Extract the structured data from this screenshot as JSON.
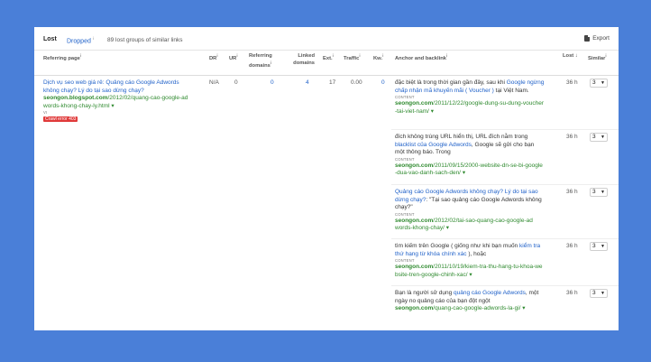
{
  "toolbar": {
    "tab_lost": "Lost",
    "tab_dropped": "Dropped",
    "lost_count_text": "89 lost groups of similar links",
    "export_label": "Export"
  },
  "columns": {
    "referring_page": "Referring page",
    "dr": "DR",
    "ur": "UR",
    "ref_domains_1": "Referring",
    "ref_domains_2": "domains",
    "linked_domains_1": "Linked",
    "linked_domains_2": "domains",
    "ext": "Ext.",
    "traffic": "Traffic",
    "kw": "Kw.",
    "anchor": "Anchor and backlink",
    "lost": "Lost",
    "similar": "Similar"
  },
  "referring": {
    "title_1": "Dịch vụ seo web giá rẻ: Quảng cáo Google Adwords",
    "title_2": "không chạy? Lý do tại sao dừng chạy?",
    "url_bold": "seongon.blogspot.com",
    "url_1": "/2012/02/quang-cao-google-ad",
    "url_2": "words-khong-chay-ly.html",
    "lang": "VI",
    "crawl_error": "Crawl error 403",
    "dr": "N/A",
    "ur": "0",
    "ref_domains": "0",
    "linked_domains": "4",
    "ext": "17",
    "traffic": "0.00",
    "kw": "0"
  },
  "backlinks": [
    {
      "t1_a": "đặc biệt là trong thời gian gần đây, sau khi ",
      "t1_b": "Google ngừng",
      "t2_a": "chấp nhận mã khuyến mãi ( Voucher )",
      "t2_b": " tại Việt Nam.",
      "tag": "CONTENT",
      "url_bold": "seongon.com",
      "url_1": "/2011/12/22/google-dung-su-dung-voucher",
      "url_2": "-tai-viet-nam/",
      "lost": "36 h",
      "similar": "3"
    },
    {
      "t1": "đích không trùng URL hiển thị, URL đích nằm trong",
      "t2_a": "blacklist của Google Adwords",
      "t2_b": ", Google sẽ gửi cho bạn",
      "t3": "một thông báo. Trong",
      "tag": "CONTENT",
      "url_bold": "seongon.com",
      "url_1": "/2011/09/15/2000-website-dn-se-bi-google",
      "url_2": "-dua-vao-danh-sach-den/",
      "lost": "36 h",
      "similar": "3"
    },
    {
      "t1": "Quảng cáo Google Adwords không chạy? Lý do tại sao",
      "t2_a": "dừng chạy?",
      "t2_b": ": \"Tại sao quảng cáo Google Adwords không",
      "t3": "chạy?\"",
      "tag": "CONTENT",
      "url_bold": "seongon.com",
      "url_1": "/2012/02/tai-sao-quang-cao-google-ad",
      "url_2": "words-khong-chay/",
      "lost": "36 h",
      "similar": "3"
    },
    {
      "t1_a": "tìm kiếm trên Google ( giống như khi bạn muốn ",
      "t1_b": "kiểm tra",
      "t2_a": "thứ hạng từ khóa chính xác",
      "t2_b": " ), hoặc",
      "tag": "CONTENT",
      "url_bold": "seongon.com",
      "url_1": "/2011/10/19/kiem-tra-thu-hang-tu-khoa-we",
      "url_2": "bsite-tren-google-chinh-xac/",
      "lost": "36 h",
      "similar": "3"
    },
    {
      "t1_a": "Bạn là người sử dụng ",
      "t1_b": "quảng cáo Google Adwords",
      "t1_c": ", một",
      "t2": "ngày no quảng cáo của bạn đột ngột",
      "url_bold": "seongon.com",
      "url_1": "/quang-cao-google-adwords-la-gi/",
      "lost": "36 h",
      "similar": "3"
    }
  ]
}
